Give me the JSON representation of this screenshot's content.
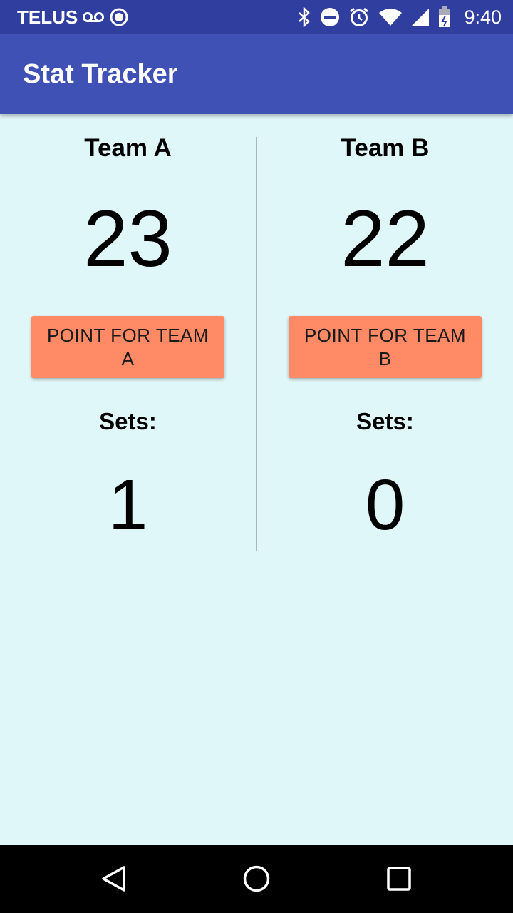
{
  "status_bar": {
    "carrier": "TELUS",
    "time": "9:40",
    "icons": [
      "voicemail-icon",
      "sync-circle-icon",
      "bluetooth-icon",
      "do-not-disturb-icon",
      "alarm-icon",
      "wifi-icon",
      "cellular-signal-icon",
      "battery-icon"
    ]
  },
  "app_bar": {
    "title": "Stat Tracker"
  },
  "team_a": {
    "name": "Team A",
    "score": "23",
    "button_label": "POINT FOR TEAM A",
    "sets_label": "Sets:",
    "sets_value": "1"
  },
  "team_b": {
    "name": "Team B",
    "score": "22",
    "button_label": "POINT FOR TEAM B",
    "sets_label": "Sets:",
    "sets_value": "0"
  },
  "colors": {
    "status_bar": "#303f9f",
    "app_bar": "#3f51b5",
    "background": "#e0f7f9",
    "button": "#ff8a65"
  },
  "nav_bar": {
    "icons": [
      "back-icon",
      "home-icon",
      "recents-icon"
    ]
  }
}
